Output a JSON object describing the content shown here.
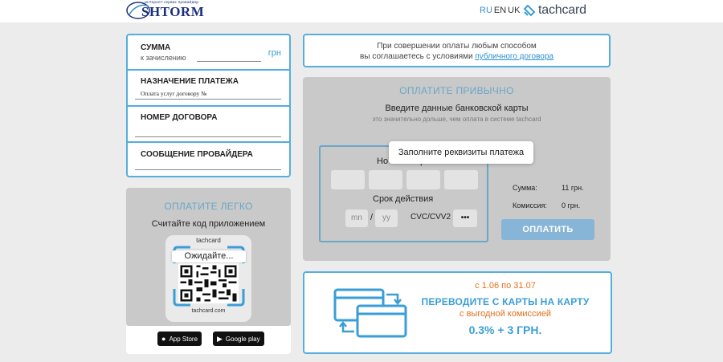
{
  "header": {
    "logo_tagline": "интернет сервис провайдер",
    "logo_text": "SHTORM",
    "languages": [
      "RU",
      "EN",
      "UK"
    ],
    "active_language": "RU",
    "brand": "tachcard"
  },
  "form": {
    "amount_label": "СУММА",
    "amount_sub": "к зачислению",
    "currency": "грн",
    "purpose_label": "НАЗНАЧЕНИЕ ПЛАТЕЖА",
    "purpose_value": "Оплата услуг договору №",
    "contract_label": "НОМЕР ДОГОВОРА",
    "provider_msg_label": "СООБЩЕНИЕ ПРОВАЙДЕРА"
  },
  "easy_pay": {
    "title": "ОПЛАТИТЕ ЛЕГКО",
    "subtitle": "Считайте код приложением",
    "brand_top": "tachcard",
    "brand_bottom": "tachcard.com",
    "waiting": "Ожидайте..."
  },
  "stores": {
    "app_store": "App Store",
    "google_play": "Google play"
  },
  "terms": {
    "line1": "При совершении оплаты любым способом",
    "line2_prefix": "вы соглашаетесь с условиями ",
    "link": "публичного договора"
  },
  "card_pay": {
    "title": "ОПЛАТИТЕ ПРИВЫЧНО",
    "subtitle": "Введите данные банковской карты",
    "note": "это значительно дольше, чем оплата в системе tachcard",
    "number_label_start": "Но",
    "number_label_end": "р",
    "expiry_label": "Срок действия",
    "month_placeholder": "mn",
    "year_placeholder": "yy",
    "cvc_label": "CVC/CVV2",
    "cvc_placeholder": "•••",
    "tooltip": "Заполните реквизиты платежа",
    "sum_label": "Сумма:",
    "sum_value": "11 грн.",
    "commission_label": "Комиссия:",
    "commission_value": "0 грн.",
    "pay_button": "ОПЛАТИТЬ"
  },
  "promo": {
    "dates": "с 1.06 по 31.07",
    "headline": "ПЕРЕВОДИТЕ С КАРТЫ НА КАРТУ",
    "subline": "с выгодной комиссией",
    "fee": "0.3% + 3 ГРН."
  },
  "colors": {
    "accent_blue": "#55aedc",
    "link_blue": "#2a8fd0",
    "orange": "#e0701e",
    "panel_gray": "#c9c9c9"
  }
}
